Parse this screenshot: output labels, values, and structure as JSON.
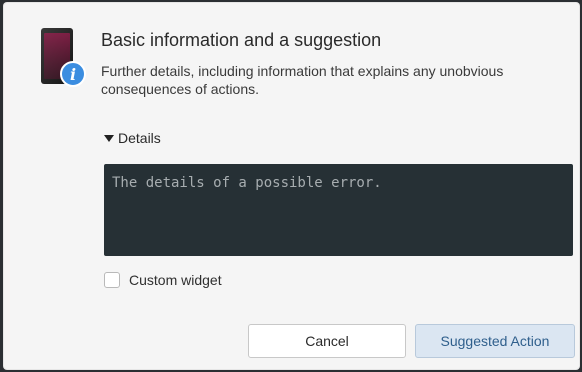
{
  "dialog": {
    "title": "Basic information and a suggestion",
    "description": "Further details, including information that explains any unobvious consequences of actions.",
    "icon": "device-info-icon",
    "details": {
      "toggle_label": "Details",
      "expanded": true,
      "placeholder": "The details of a possible error."
    },
    "custom_widget": {
      "label": "Custom widget",
      "checked": false
    },
    "buttons": {
      "cancel_label": "Cancel",
      "suggested_label": "Suggested Action"
    }
  },
  "colors": {
    "dialog_bg": "#f5f5f5",
    "details_bg": "#263035",
    "suggested_bg": "#dbe6f2",
    "suggested_text": "#2f5f8c",
    "info_badge": "#3b8de0"
  }
}
